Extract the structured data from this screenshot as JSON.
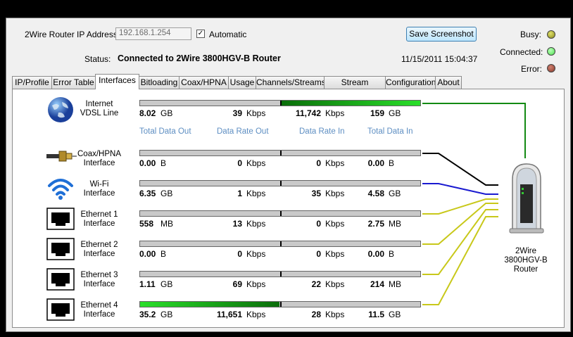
{
  "top": {
    "ip_label": "2Wire Router IP Address:",
    "ip_value": "192.168.1.254",
    "automatic_label": "Automatic",
    "automatic_checked": true,
    "status_label": "Status:",
    "status_value": "Connected to 2Wire 3800HGV-B Router",
    "save_button": "Save Screenshot",
    "timestamp": "11/15/2011 15:04:37"
  },
  "indicators": {
    "busy": {
      "label": "Busy:",
      "color": "#8a8a1e"
    },
    "connected": {
      "label": "Connected:",
      "color": "#4ee04e"
    },
    "error": {
      "label": "Error:",
      "color": "#8a3a2a"
    }
  },
  "tabs": [
    "IP/Profile",
    "Error Table",
    "Interfaces",
    "Bitloading",
    "Coax/HPNA",
    "Usage",
    "Channels/Streams",
    "Stream Analyzer",
    "Configuration",
    "About"
  ],
  "active_tab": "Interfaces",
  "headers": {
    "total_out": "Total Data Out",
    "rate_out": "Data Rate Out",
    "rate_in": "Data Rate In",
    "total_in": "Total Data In"
  },
  "interfaces": [
    {
      "name": "Internet\nVDSL Line",
      "icon": "globe-icon",
      "total_out": "8.02",
      "total_out_unit": "GB",
      "rate_out": "39",
      "rate_out_unit": "Kbps",
      "rate_in": "11,742",
      "rate_in_unit": "Kbps",
      "total_in": "159",
      "total_in_unit": "GB",
      "out_fill": 0,
      "in_fill": 1.0,
      "line_color": "#138a13"
    },
    {
      "name": "Coax/HPNA\nInterface",
      "icon": "coax-cable-icon",
      "total_out": "0.00",
      "total_out_unit": "B",
      "rate_out": "0",
      "rate_out_unit": "Kbps",
      "rate_in": "0",
      "rate_in_unit": "Kbps",
      "total_in": "0.00",
      "total_in_unit": "B",
      "out_fill": 0,
      "in_fill": 0,
      "line_color": "#000000"
    },
    {
      "name": "Wi-Fi\nInterface",
      "icon": "wifi-icon",
      "total_out": "6.35",
      "total_out_unit": "GB",
      "rate_out": "1",
      "rate_out_unit": "Kbps",
      "rate_in": "35",
      "rate_in_unit": "Kbps",
      "total_in": "4.58",
      "total_in_unit": "GB",
      "out_fill": 0,
      "in_fill": 0,
      "line_color": "#1a1ad0"
    },
    {
      "name": "Ethernet 1\nInterface",
      "icon": "ethernet-port-icon",
      "total_out": "558",
      "total_out_unit": "MB",
      "rate_out": "13",
      "rate_out_unit": "Kbps",
      "rate_in": "0",
      "rate_in_unit": "Kbps",
      "total_in": "2.75",
      "total_in_unit": "MB",
      "out_fill": 0,
      "in_fill": 0,
      "line_color": "#c8c81a"
    },
    {
      "name": "Ethernet 2\nInterface",
      "icon": "ethernet-port-icon",
      "total_out": "0.00",
      "total_out_unit": "B",
      "rate_out": "0",
      "rate_out_unit": "Kbps",
      "rate_in": "0",
      "rate_in_unit": "Kbps",
      "total_in": "0.00",
      "total_in_unit": "B",
      "out_fill": 0,
      "in_fill": 0,
      "line_color": "#c8c81a"
    },
    {
      "name": "Ethernet 3\nInterface",
      "icon": "ethernet-port-icon",
      "total_out": "1.11",
      "total_out_unit": "GB",
      "rate_out": "69",
      "rate_out_unit": "Kbps",
      "rate_in": "22",
      "rate_in_unit": "Kbps",
      "total_in": "214",
      "total_in_unit": "MB",
      "out_fill": 0,
      "in_fill": 0,
      "line_color": "#c8c81a"
    },
    {
      "name": "Ethernet 4\nInterface",
      "icon": "ethernet-port-icon",
      "total_out": "35.2",
      "total_out_unit": "GB",
      "rate_out": "11,651",
      "rate_out_unit": "Kbps",
      "rate_in": "28",
      "rate_in_unit": "Kbps",
      "total_in": "11.5",
      "total_in_unit": "GB",
      "out_fill": 1.0,
      "in_fill": 0,
      "line_color": "#c8c81a"
    }
  ],
  "router": {
    "label": "2Wire\n3800HGV-B\nRouter",
    "icon": "router-icon"
  }
}
